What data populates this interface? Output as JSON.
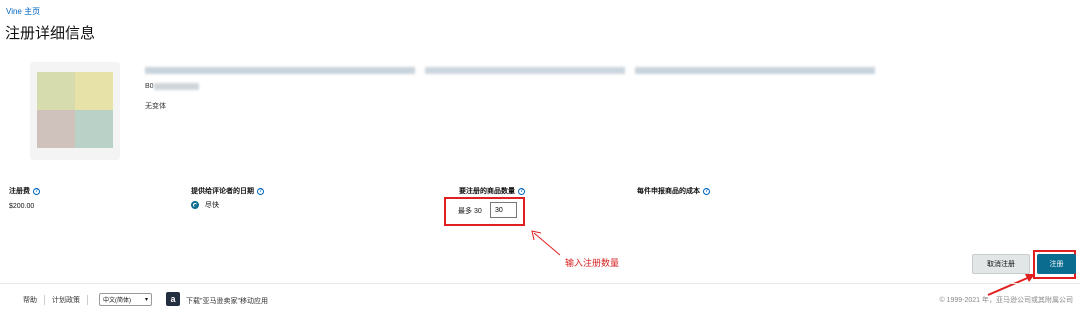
{
  "breadcrumb": "Vine 主页",
  "page_title": "注册详细信息",
  "product": {
    "asin_prefix": "B0",
    "variation": "无变体"
  },
  "columns": {
    "fee": {
      "label": "注册费",
      "value": "$200.00"
    },
    "review_date": {
      "label": "提供给评论者的日期",
      "option": "尽快"
    },
    "quantity": {
      "label": "要注册的商品数量",
      "max_label": "最多 30",
      "value": "30"
    },
    "cost": {
      "label": "每件申报商品的成本"
    }
  },
  "annotation": "输入注册数量",
  "buttons": {
    "cancel": "取消注册",
    "register": "注册"
  },
  "footer": {
    "help": "帮助",
    "policy": "计划政策",
    "language": "中文(简体)",
    "app_icon_letter": "a",
    "app_text": "下载\"亚马逊卖家\"移动应用",
    "copyright": "© 1999-2021 年，亚马逊公司或其附属公司"
  },
  "colors": {
    "accent": "#0a6d8f",
    "annotation_red": "#e02020",
    "link": "#0066c0"
  },
  "icons": [
    "info-icon",
    "radio-icon",
    "dropdown-arrow-icon",
    "amazon-app-icon",
    "arrow-icon"
  ]
}
